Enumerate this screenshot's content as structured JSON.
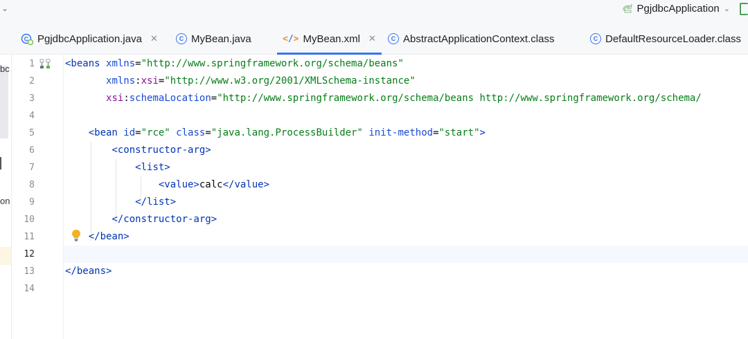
{
  "run_config": {
    "label": "PgjdbcApplication"
  },
  "tabs": [
    {
      "label": "PgjdbcApplication.java",
      "icon": "spring-class-icon",
      "closable": true,
      "active": false
    },
    {
      "label": "MyBean.java",
      "icon": "class-icon",
      "closable": false,
      "active": false
    },
    {
      "label": "MyBean.xml",
      "icon": "xml-file-icon",
      "closable": true,
      "active": true
    },
    {
      "label": "AbstractApplicationContext.class",
      "icon": "class-icon",
      "closable": false,
      "active": false
    },
    {
      "label": "DefaultResourceLoader.class",
      "icon": "class-icon",
      "closable": false,
      "active": false
    }
  ],
  "left_pane": {
    "fragment_top": "bc",
    "fragment_mid": "on"
  },
  "editor": {
    "current_line": 12,
    "line_numbers": [
      "1",
      "2",
      "3",
      "4",
      "5",
      "6",
      "7",
      "8",
      "9",
      "10",
      "11",
      "12",
      "13",
      "14"
    ],
    "lines": [
      [
        {
          "c": "t",
          "s": "<beans "
        },
        {
          "c": "a",
          "s": "xmlns"
        },
        {
          "c": "p",
          "s": "="
        },
        {
          "c": "v",
          "s": "\"http://www.springframework.org/schema/beans\""
        }
      ],
      [
        {
          "c": "p",
          "s": "       "
        },
        {
          "c": "a",
          "s": "xmlns"
        },
        {
          "c": "p",
          "s": ":"
        },
        {
          "c": "ns",
          "s": "xsi"
        },
        {
          "c": "p",
          "s": "="
        },
        {
          "c": "v",
          "s": "\"http://www.w3.org/2001/XMLSchema-instance\""
        }
      ],
      [
        {
          "c": "p",
          "s": "       "
        },
        {
          "c": "ns",
          "s": "xsi"
        },
        {
          "c": "p",
          "s": ":"
        },
        {
          "c": "a",
          "s": "schemaLocation"
        },
        {
          "c": "p",
          "s": "="
        },
        {
          "c": "v",
          "s": "\"http://www.springframework.org/schema/beans http://www.springframework.org/schema/"
        }
      ],
      [],
      [
        {
          "c": "p",
          "s": "    "
        },
        {
          "c": "t",
          "s": "<bean "
        },
        {
          "c": "a",
          "s": "id"
        },
        {
          "c": "p",
          "s": "="
        },
        {
          "c": "v",
          "s": "\"rce\" "
        },
        {
          "c": "a",
          "s": "class"
        },
        {
          "c": "p",
          "s": "="
        },
        {
          "c": "v",
          "s": "\"java.lang.ProcessBuilder\" "
        },
        {
          "c": "a",
          "s": "init-method"
        },
        {
          "c": "p",
          "s": "="
        },
        {
          "c": "v",
          "s": "\"start\""
        },
        {
          "c": "t",
          "s": ">"
        }
      ],
      [
        {
          "c": "p",
          "s": "        "
        },
        {
          "c": "t",
          "s": "<constructor-arg>"
        }
      ],
      [
        {
          "c": "p",
          "s": "            "
        },
        {
          "c": "t",
          "s": "<list>"
        }
      ],
      [
        {
          "c": "p",
          "s": "                "
        },
        {
          "c": "t",
          "s": "<value>"
        },
        {
          "c": "p",
          "s": "calc"
        },
        {
          "c": "t",
          "s": "</value>"
        }
      ],
      [
        {
          "c": "p",
          "s": "            "
        },
        {
          "c": "t",
          "s": "</list>"
        }
      ],
      [
        {
          "c": "p",
          "s": "        "
        },
        {
          "c": "t",
          "s": "</constructor-arg>"
        }
      ],
      [
        {
          "c": "p",
          "s": "    "
        },
        {
          "c": "t",
          "s": "</bean>"
        }
      ],
      [],
      [
        {
          "c": "t",
          "s": "</beans>"
        }
      ],
      []
    ]
  },
  "icons": {
    "intention": "lightbulb-icon",
    "structure": "structure-icon"
  },
  "colors": {
    "accent": "#3574f0",
    "tag": "#0033b3",
    "attr": "#174ad4",
    "namespace": "#871094",
    "string": "#067d17",
    "bulb": "#f2b120"
  }
}
